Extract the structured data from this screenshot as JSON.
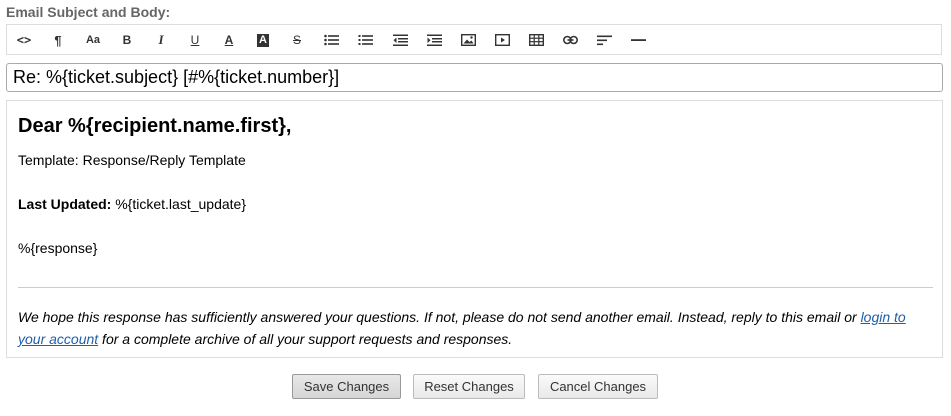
{
  "section_label": "Email Subject and Body:",
  "toolbar": {
    "buttons": [
      {
        "name": "code-view-icon",
        "glyph": "<>"
      },
      {
        "name": "paragraph-icon",
        "glyph": "¶"
      },
      {
        "name": "font-size-icon",
        "glyph": "Aa"
      },
      {
        "name": "bold-icon",
        "glyph": "B"
      },
      {
        "name": "italic-icon",
        "glyph": "I"
      },
      {
        "name": "underline-icon",
        "glyph": "U"
      },
      {
        "name": "font-color-icon",
        "glyph": "A"
      },
      {
        "name": "background-color-icon",
        "glyph": "A"
      },
      {
        "name": "strikethrough-icon",
        "glyph": "S"
      },
      {
        "name": "unordered-list-icon",
        "glyph": ""
      },
      {
        "name": "ordered-list-icon",
        "glyph": ""
      },
      {
        "name": "outdent-icon",
        "glyph": ""
      },
      {
        "name": "indent-icon",
        "glyph": ""
      },
      {
        "name": "insert-image-icon",
        "glyph": ""
      },
      {
        "name": "insert-video-icon",
        "glyph": ""
      },
      {
        "name": "insert-table-icon",
        "glyph": ""
      },
      {
        "name": "insert-link-icon",
        "glyph": ""
      },
      {
        "name": "align-icon",
        "glyph": ""
      },
      {
        "name": "horizontal-rule-icon",
        "glyph": ""
      }
    ]
  },
  "subject": {
    "value": "Re: %{ticket.subject} [#%{ticket.number}]"
  },
  "body": {
    "greeting": "Dear %{recipient.name.first},",
    "template_line": "Template: Response/Reply Template",
    "last_updated_label": "Last Updated:",
    "last_updated_value": " %{ticket.last_update}",
    "response_var": "%{response}",
    "footer_before_link": "We hope this response has sufficiently answered your questions. If not, please do not send another email. Instead, reply to this email or ",
    "footer_link": "login to your account",
    "footer_after_link": " for a complete archive of all your support requests and responses."
  },
  "actions": {
    "save": "Save Changes",
    "reset": "Reset Changes",
    "cancel": "Cancel Changes"
  },
  "colors": {
    "link": "#1e5fa8",
    "label": "#666666"
  }
}
